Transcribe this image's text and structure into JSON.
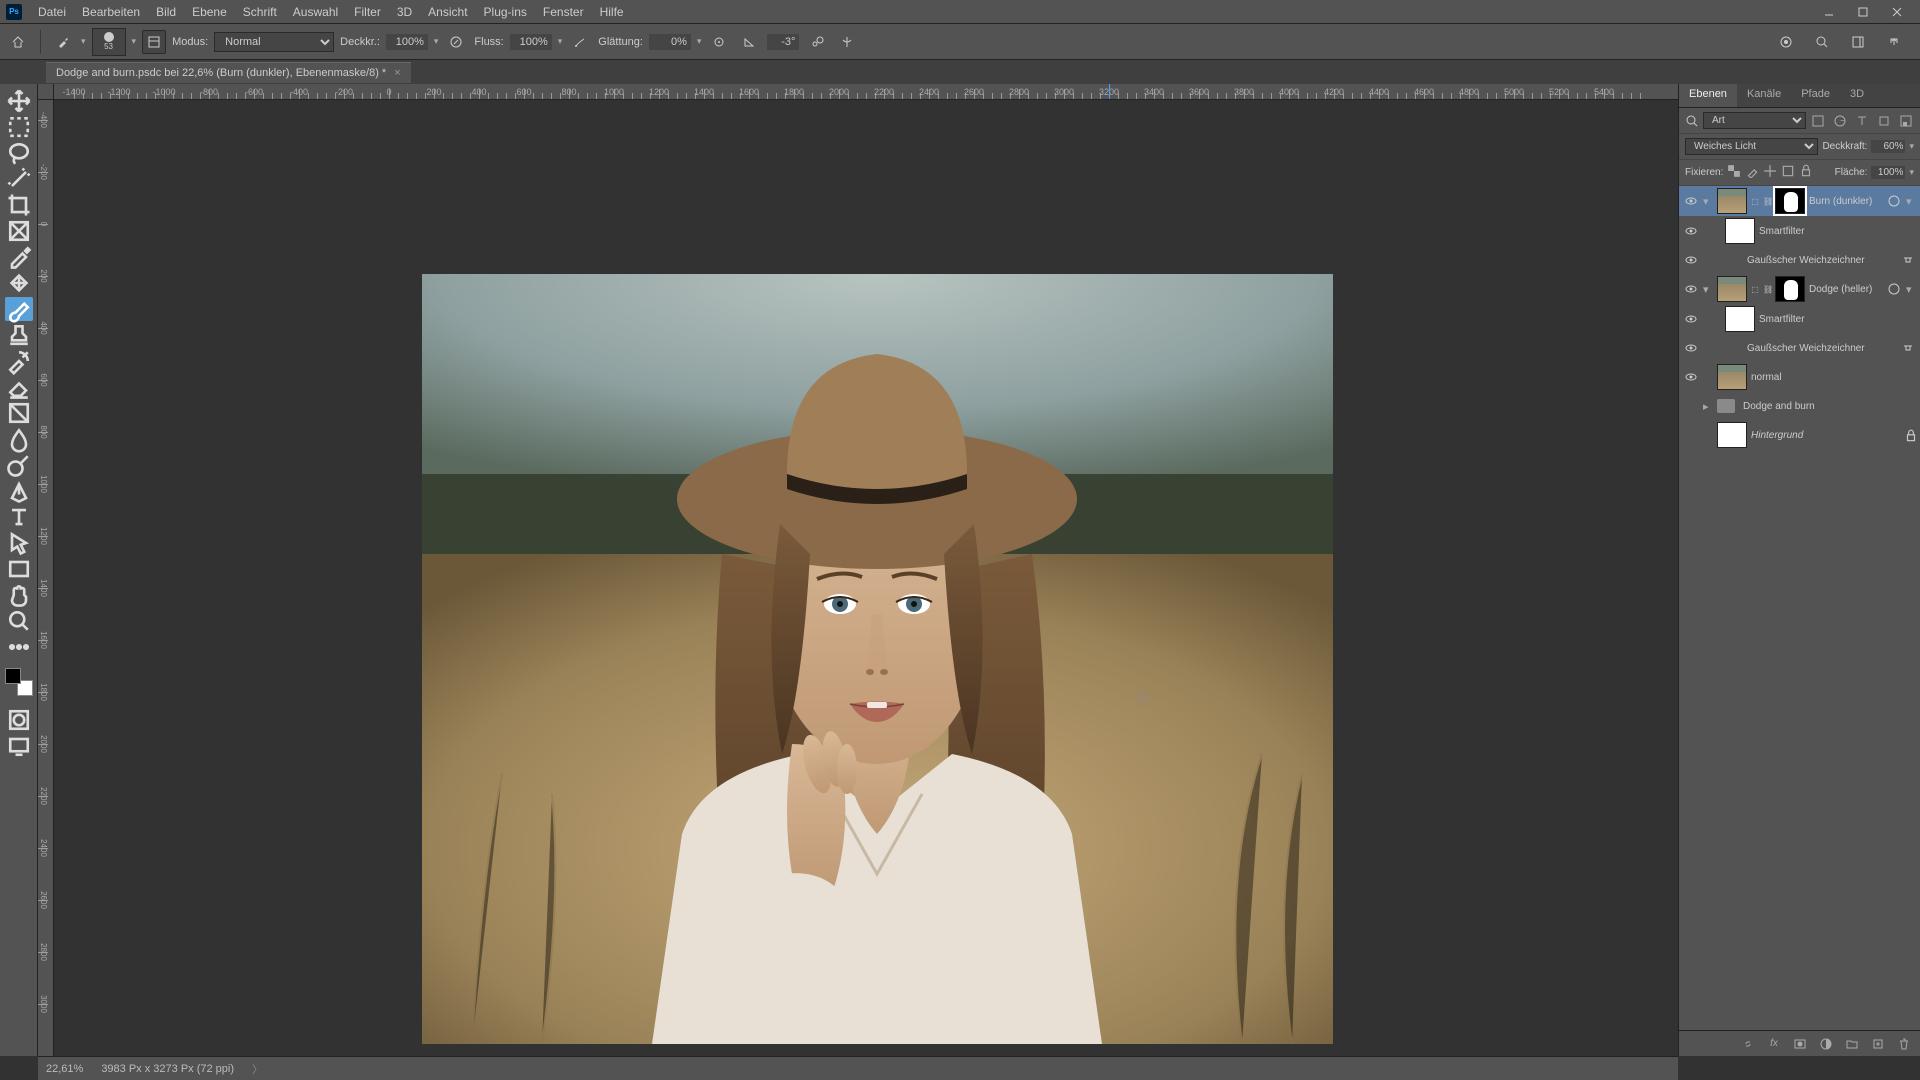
{
  "menu": {
    "items": [
      "Datei",
      "Bearbeiten",
      "Bild",
      "Ebene",
      "Schrift",
      "Auswahl",
      "Filter",
      "3D",
      "Ansicht",
      "Plug-ins",
      "Fenster",
      "Hilfe"
    ]
  },
  "options": {
    "brush_size": "53",
    "modus_label": "Modus:",
    "modus_value": "Normal",
    "deckkr_label": "Deckkr.:",
    "deckkr_value": "100%",
    "fluss_label": "Fluss:",
    "fluss_value": "100%",
    "glaettung_label": "Glättung:",
    "glaettung_value": "0%",
    "angle_value": "-3°"
  },
  "document": {
    "tab_title": "Dodge and burn.psdc bei 22,6% (Burn (dunkler), Ebenenmaske/8) *"
  },
  "ruler_h": [
    "-1400",
    "-1200",
    "-1000",
    "-800",
    "-600",
    "-400",
    "-200",
    "0",
    "200",
    "400",
    "600",
    "800",
    "1000",
    "1200",
    "1400",
    "1600",
    "1800",
    "2000",
    "2200",
    "2400",
    "2600",
    "2800",
    "3000",
    "3200",
    "3400",
    "3600",
    "3800",
    "4000",
    "4200",
    "4400",
    "4600",
    "4800",
    "5000",
    "5200",
    "5400"
  ],
  "ruler_h_marker_index": 23,
  "ruler_v": [
    "-400",
    "-200",
    "0",
    "200",
    "400",
    "600",
    "800",
    "1000",
    "1200",
    "1400",
    "1600",
    "1800",
    "2000",
    "2200",
    "2400",
    "2600",
    "2800",
    "3000"
  ],
  "panels": {
    "tabs": [
      "Ebenen",
      "Kanäle",
      "Pfade",
      "3D"
    ],
    "search_label": "Art",
    "blend_mode": "Weiches Licht",
    "deckkraft_label": "Deckkraft:",
    "deckkraft_value": "60%",
    "fixieren_label": "Fixieren:",
    "flaeche_label": "Fläche:",
    "flaeche_value": "100%"
  },
  "layers": [
    {
      "id": "burn",
      "name": "Burn (dunkler)",
      "visible": true,
      "smart": true,
      "mask": true,
      "selected": true,
      "fx": true,
      "indent": 0,
      "thumb": "photo"
    },
    {
      "id": "burn-sf",
      "name": "Smartfilter",
      "visible": true,
      "indent": 1,
      "thumb": "white",
      "italic": false
    },
    {
      "id": "burn-gauss",
      "name": "Gaußscher Weichzeichner",
      "visible": true,
      "indent": 2,
      "fxtoggle": true
    },
    {
      "id": "dodge",
      "name": "Dodge (heller)",
      "visible": true,
      "smart": true,
      "mask": true,
      "fx": true,
      "indent": 0,
      "thumb": "photo"
    },
    {
      "id": "dodge-sf",
      "name": "Smartfilter",
      "visible": true,
      "indent": 1,
      "thumb": "white"
    },
    {
      "id": "dodge-gauss",
      "name": "Gaußscher Weichzeichner",
      "visible": true,
      "indent": 2,
      "fxtoggle": true
    },
    {
      "id": "normal",
      "name": "normal",
      "visible": true,
      "indent": 0,
      "thumb": "photo"
    },
    {
      "id": "group",
      "name": "Dodge and burn",
      "visible": false,
      "indent": 0,
      "folder": true
    },
    {
      "id": "bg",
      "name": "Hintergrund",
      "visible": false,
      "indent": 0,
      "thumb": "white",
      "locked": true,
      "italic": true
    }
  ],
  "status": {
    "zoom": "22,61%",
    "dims": "3983 Px x 3273 Px (72 ppi)"
  },
  "colors": {
    "accent": "#5a7aa0",
    "panel": "#535353",
    "canvas": "#323232"
  }
}
